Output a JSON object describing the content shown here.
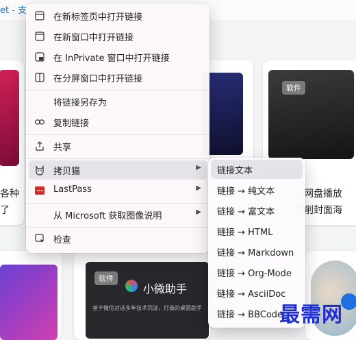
{
  "page": {
    "top_text": "et - 支",
    "left_card_text_1": "各种",
    "left_card_text_2": "了",
    "right_card_text_1": "品网盘播放",
    "right_card_text_2": "刮削封面海",
    "badge_top": "软件",
    "badge_bottom": "软件",
    "app_card_title": "小微助手",
    "app_card_desc": "基于微信对话多年技术沉淀，打造的桌面助手",
    "watermark": "最需网"
  },
  "context_menu": {
    "items": [
      {
        "label": "在新标签页中打开链接",
        "icon": "new-tab-icon"
      },
      {
        "label": "在新窗口中打开链接",
        "icon": "new-window-icon"
      },
      {
        "label": "在 InPrivate 窗口中打开链接",
        "icon": "inprivate-icon"
      },
      {
        "label": "在分屏窗口中打开链接",
        "icon": "split-screen-icon"
      },
      {
        "label": "将链接另存为",
        "icon": ""
      },
      {
        "label": "复制链接",
        "icon": "link-icon"
      },
      {
        "label": "共享",
        "icon": "share-icon"
      },
      {
        "label": "拷贝猫",
        "icon": "cat-icon"
      },
      {
        "label": "LastPass",
        "icon": "lastpass-icon"
      },
      {
        "label": "从 Microsoft 获取图像说明",
        "icon": ""
      },
      {
        "label": "检查",
        "icon": "inspect-icon"
      }
    ]
  },
  "submenu": {
    "items": [
      "链接文本",
      "链接 → 纯文本",
      "链接 → 富文本",
      "链接 → HTML",
      "链接 → Markdown",
      "链接 → Org-Mode",
      "链接 → AsciiDoc",
      "链接 → BBCode"
    ]
  },
  "colors": {
    "accent": "#1a73c9",
    "lastpass": "#d32d27",
    "watermark": "#1f2fd6"
  }
}
